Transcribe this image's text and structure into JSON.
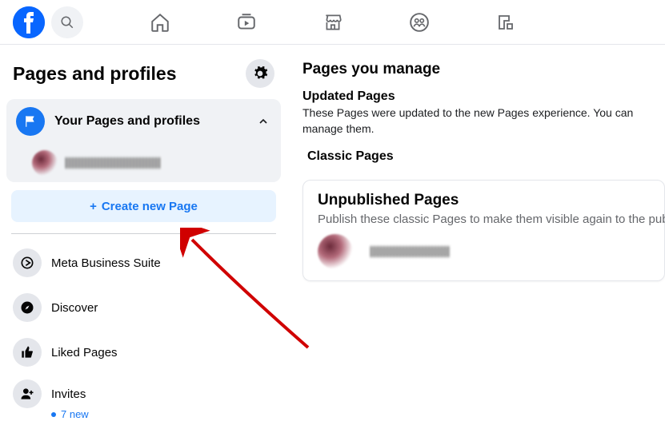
{
  "sidebar": {
    "title": "Pages and profiles",
    "yourPagesLabel": "Your Pages and profiles",
    "createLabel": "Create new Page",
    "items": [
      {
        "label": "Meta Business Suite"
      },
      {
        "label": "Discover"
      },
      {
        "label": "Liked Pages"
      },
      {
        "label": "Invites",
        "sub": "7 new"
      }
    ]
  },
  "content": {
    "heading": "Pages you manage",
    "updated": {
      "title": "Updated Pages",
      "desc": "These Pages were updated to the new Pages experience. You can manage them."
    },
    "classicTitle": "Classic Pages",
    "unpublished": {
      "title": "Unpublished Pages",
      "desc": "Publish these classic Pages to make them visible again to the public."
    }
  }
}
